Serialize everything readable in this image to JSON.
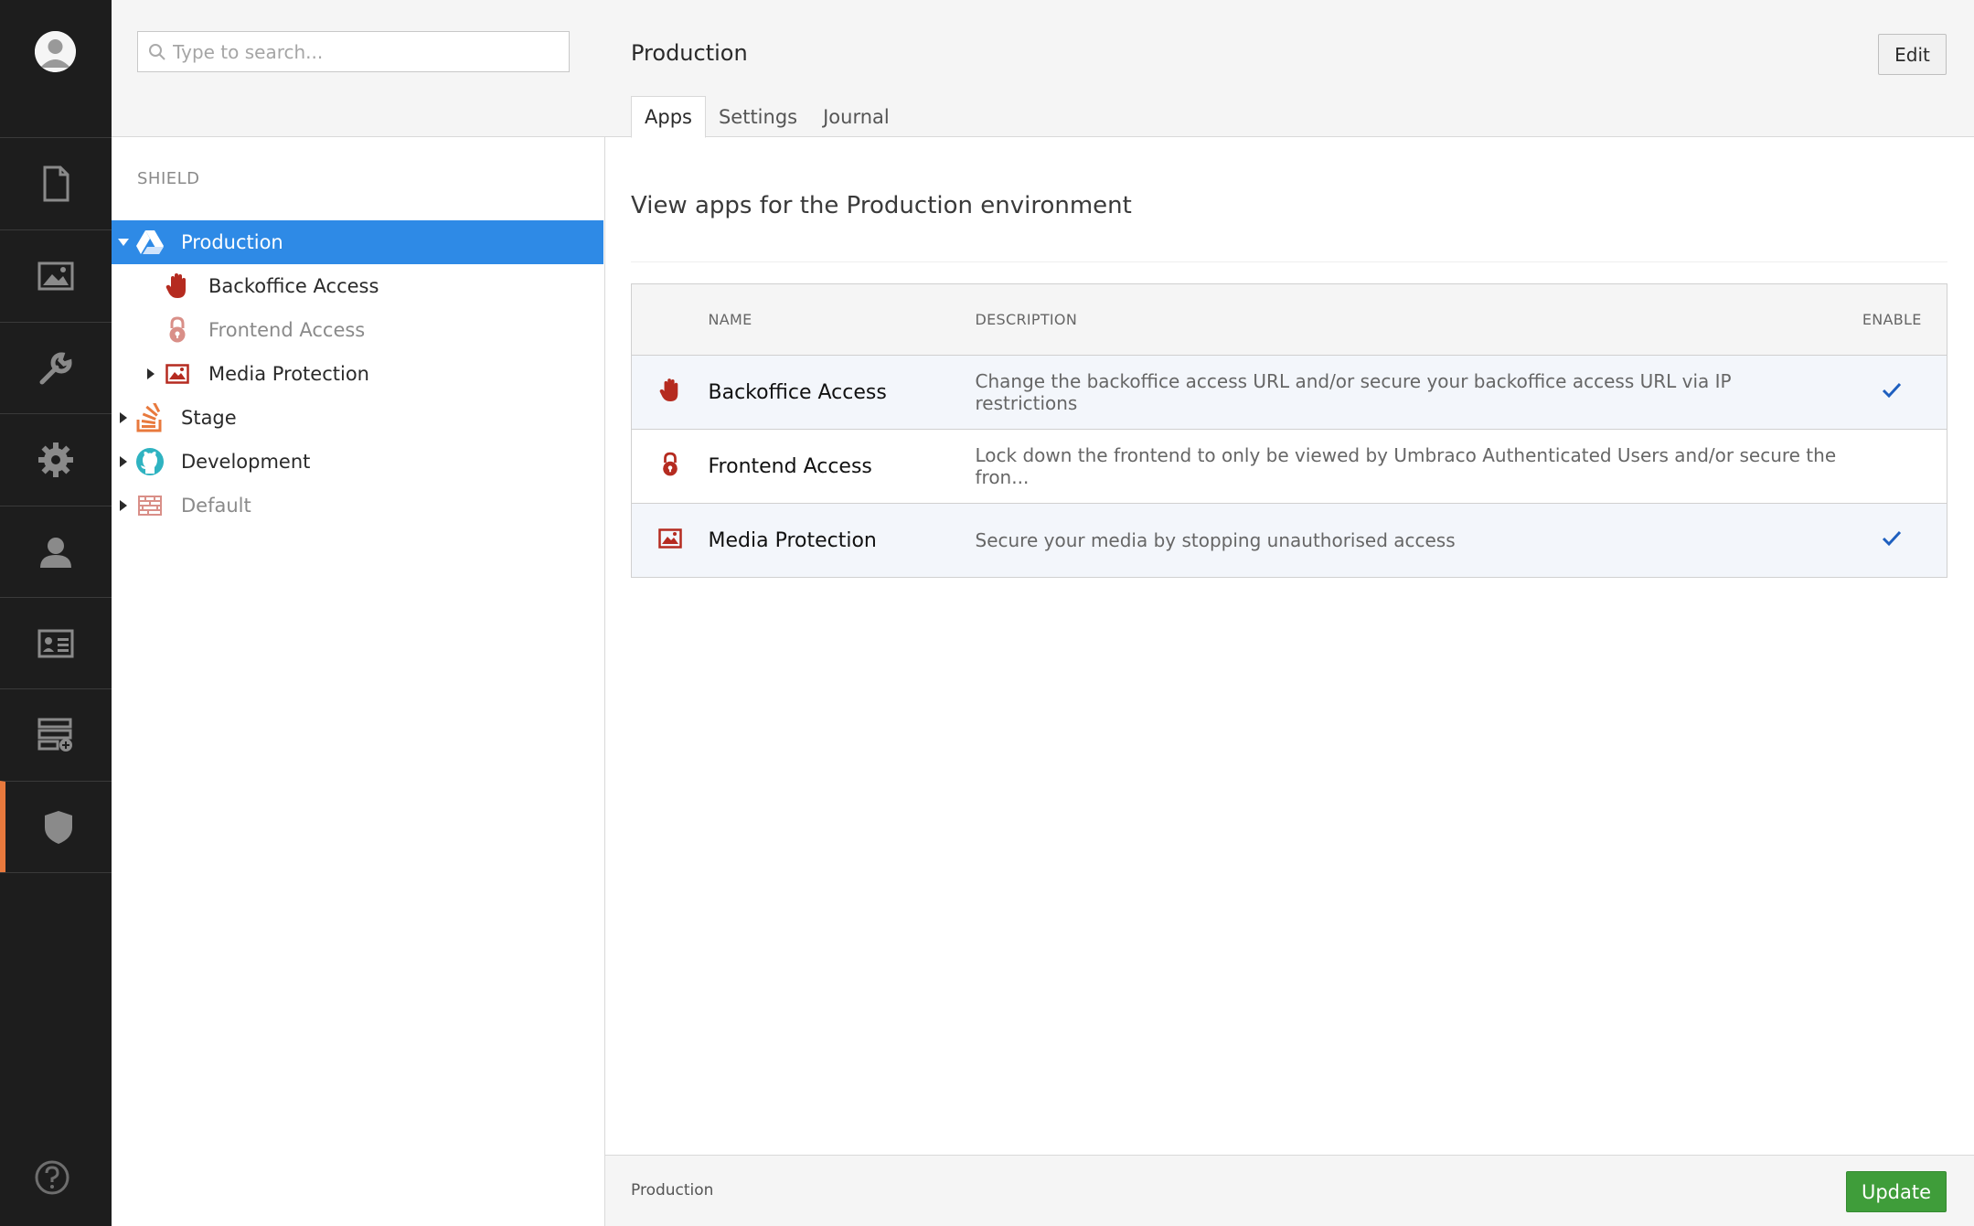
{
  "nav": {
    "items": [
      {
        "icon": "content-icon",
        "active": false
      },
      {
        "icon": "media-icon",
        "active": false
      },
      {
        "icon": "wrench-icon",
        "active": false
      },
      {
        "icon": "settings-gear-icon",
        "active": false
      },
      {
        "icon": "user-icon",
        "active": false
      },
      {
        "icon": "member-card-icon",
        "active": false
      },
      {
        "icon": "forms-icon",
        "active": false
      },
      {
        "icon": "shield-icon",
        "active": true
      }
    ],
    "help_icon": "help-icon"
  },
  "tree": {
    "search_placeholder": "Type to search...",
    "section_label": "SHIELD",
    "nodes": [
      {
        "label": "Production",
        "icon": "production-drive-icon",
        "selected": true,
        "expanded": true
      },
      {
        "label": "Backoffice Access",
        "icon": "hand-stop-icon"
      },
      {
        "label": "Frontend Access",
        "icon": "padlock-icon",
        "muted": true
      },
      {
        "label": "Media Protection",
        "icon": "image-icon"
      },
      {
        "label": "Stage",
        "icon": "stackoverflow-icon"
      },
      {
        "label": "Development",
        "icon": "github-icon"
      },
      {
        "label": "Default",
        "icon": "brick-wall-icon",
        "muted": true
      }
    ]
  },
  "main": {
    "title": "Production",
    "edit_label": "Edit",
    "tabs": [
      {
        "label": "Apps",
        "active": true
      },
      {
        "label": "Settings"
      },
      {
        "label": "Journal"
      }
    ],
    "lead": "View apps for the Production environment",
    "table": {
      "headers": {
        "name": "NAME",
        "description": "DESCRIPTION",
        "enable": "ENABLE"
      },
      "rows": [
        {
          "name": "Backoffice Access",
          "description": "Change the backoffice access URL and/or secure your backoffice access URL via IP restrictions",
          "enabled": true,
          "icon": "hand-stop-icon"
        },
        {
          "name": "Frontend Access",
          "description": "Lock down the frontend to only be viewed by Umbraco Authenticated Users and/or secure the fron...",
          "enabled": false,
          "icon": "padlock-icon"
        },
        {
          "name": "Media Protection",
          "description": "Secure your media by stopping unauthorised access",
          "enabled": true,
          "icon": "image-icon"
        }
      ]
    }
  },
  "footer": {
    "breadcrumb": "Production",
    "update_label": "Update"
  },
  "colors": {
    "nav_bg": "#1d1d1d",
    "nav_active_accent": "#e8793d",
    "selection": "#2e8ae6",
    "check": "#1e5fbf",
    "update_bg": "#3f9d3a",
    "app_icon_red": "#b52b20"
  }
}
